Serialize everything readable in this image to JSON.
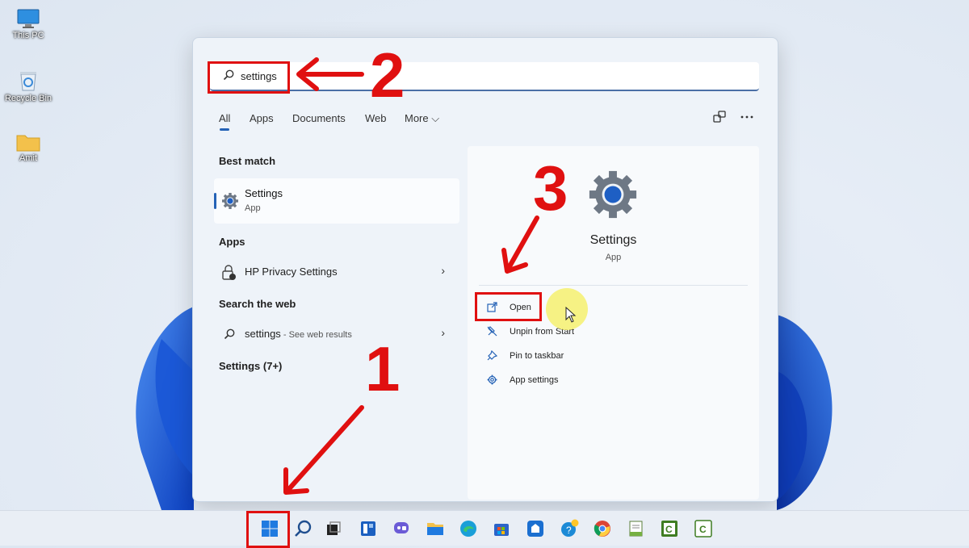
{
  "desktop": {
    "icons": [
      {
        "label": "This PC",
        "icon": "monitor-icon"
      },
      {
        "label": "Recycle Bin",
        "icon": "recycle-bin-icon"
      },
      {
        "label": "Amit",
        "icon": "folder-icon"
      }
    ]
  },
  "search": {
    "value": "settings",
    "icon": "search-icon"
  },
  "tabs": [
    {
      "label": "All",
      "active": true
    },
    {
      "label": "Apps"
    },
    {
      "label": "Documents"
    },
    {
      "label": "Web"
    },
    {
      "label": "More ⌵"
    }
  ],
  "toolbar": {
    "share_icon": "device-share-icon",
    "more_icon": "more-dots-icon"
  },
  "sections": {
    "best_match": "Best match",
    "apps": "Apps",
    "search_web": "Search the web",
    "settings_more": "Settings (7+)"
  },
  "best_match": {
    "title": "Settings",
    "subtitle": "App",
    "icon": "gear-icon"
  },
  "apps": [
    {
      "label": "HP Privacy Settings",
      "icon": "privacy-lock-icon"
    }
  ],
  "web": {
    "query": "settings",
    "suffix": " - See web results"
  },
  "preview": {
    "title": "Settings",
    "subtitle": "App",
    "actions": [
      {
        "label": "Open",
        "icon": "open-external-icon"
      },
      {
        "label": "Unpin from Start",
        "icon": "unpin-icon"
      },
      {
        "label": "Pin to taskbar",
        "icon": "pin-icon"
      },
      {
        "label": "App settings",
        "icon": "gear-icon"
      }
    ]
  },
  "annotations": {
    "n1": "1",
    "n2": "2",
    "n3": "3",
    "color": "#e01010"
  },
  "taskbar": {
    "items": [
      "start-icon",
      "search-icon",
      "task-view-icon",
      "widgets-icon",
      "chat-icon",
      "file-explorer-icon",
      "edge-icon",
      "store-icon",
      "app-icon",
      "tips-icon",
      "chrome-icon",
      "notepad-icon",
      "camtasia-icon",
      "camtasia-icon"
    ]
  },
  "colors": {
    "accent": "#2462b6",
    "annotation": "#e01010"
  }
}
